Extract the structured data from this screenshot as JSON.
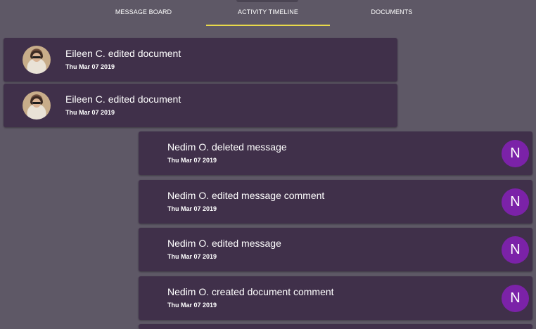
{
  "tabs": [
    {
      "label": "MESSAGE BOARD",
      "active": false
    },
    {
      "label": "ACTIVITY TIMELINE",
      "active": true
    },
    {
      "label": "DOCUMENTS",
      "active": false
    }
  ],
  "colors": {
    "background": "#5e5866",
    "card": "#40304a",
    "accent_underline": "#e8d94a",
    "avatar_purple": "#7b22a8"
  },
  "activities": [
    {
      "user": "Eileen C.",
      "text": "Eileen C. edited document",
      "date": "Thu Mar 07 2019",
      "avatar": "photo"
    },
    {
      "user": "Eileen C.",
      "text": "Eileen C. edited document",
      "date": "Thu Mar 07 2019",
      "avatar": "photo"
    },
    {
      "user": "Nedim O.",
      "text": "Nedim O. deleted message",
      "date": "Thu Mar 07 2019",
      "avatar": "N"
    },
    {
      "user": "Nedim O.",
      "text": "Nedim O. edited message comment",
      "date": "Thu Mar 07 2019",
      "avatar": "N"
    },
    {
      "user": "Nedim O.",
      "text": "Nedim O. edited message",
      "date": "Thu Mar 07 2019",
      "avatar": "N"
    },
    {
      "user": "Nedim O.",
      "text": "Nedim O. created document comment",
      "date": "Thu Mar 07 2019",
      "avatar": "N"
    }
  ]
}
